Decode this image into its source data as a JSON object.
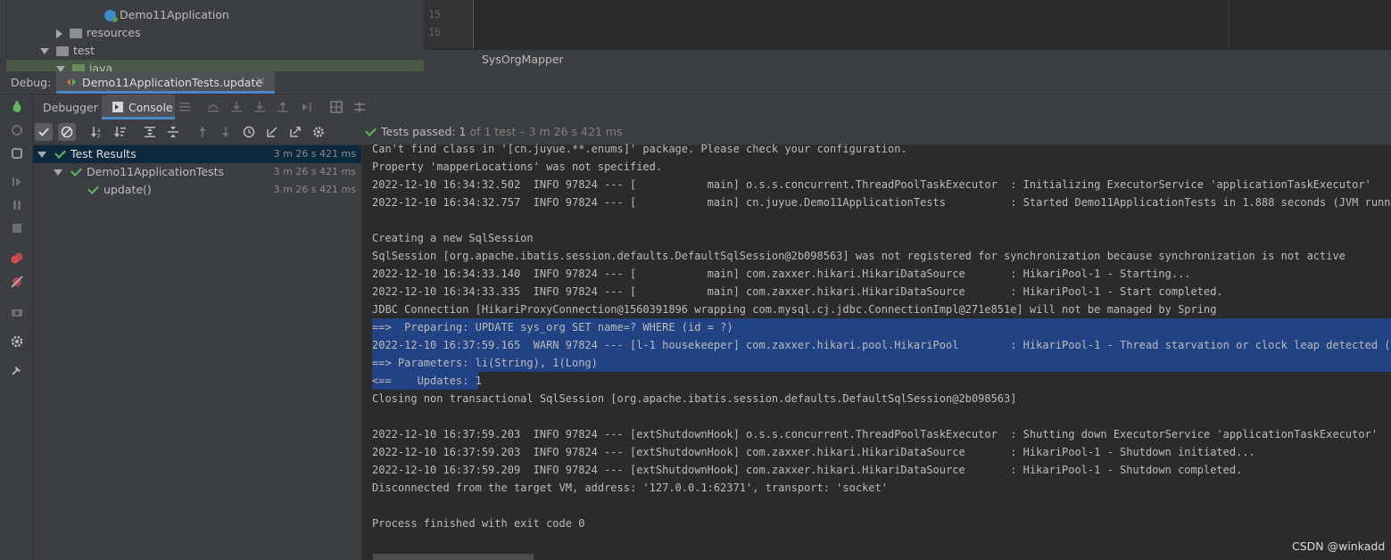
{
  "project_tree": {
    "items": [
      {
        "label": "Demo11Application",
        "kind": "app"
      },
      {
        "label": "resources",
        "kind": "folder"
      },
      {
        "label": "test",
        "kind": "folder"
      },
      {
        "label": "java",
        "kind": "folder"
      }
    ]
  },
  "editor": {
    "line_numbers": [
      "15",
      "16"
    ],
    "tab_label": "SysOrgMapper"
  },
  "debug": {
    "label": "Debug:",
    "session_tab": "Demo11ApplicationTests.update"
  },
  "tabs": {
    "debugger": "Debugger",
    "console": "Console"
  },
  "status": {
    "prefix": "Tests passed: ",
    "passed": "1",
    "rest": " of 1 test – 3 m 26 s 421 ms"
  },
  "test_tree": [
    {
      "label": "Test Results",
      "time": "3 m 26 s 421 ms"
    },
    {
      "label": "Demo11ApplicationTests",
      "time": "3 m 26 s 421 ms"
    },
    {
      "label": "update()",
      "time": "3 m 26 s 421 ms"
    }
  ],
  "console_lines": [
    "Can't find class in '[cn.juyue.**.enums]' package. Please check your configuration.",
    "Property 'mapperLocations' was not specified.",
    "2022-12-10 16:34:32.502  INFO 97824 --- [           main] o.s.s.concurrent.ThreadPoolTaskExecutor  : Initializing ExecutorService 'applicationTaskExecutor'",
    "2022-12-10 16:34:32.757  INFO 97824 --- [           main] cn.juyue.Demo11ApplicationTests          : Started Demo11ApplicationTests in 1.888 seconds (JVM running for",
    "",
    "Creating a new SqlSession",
    "SqlSession [org.apache.ibatis.session.defaults.DefaultSqlSession@2b098563] was not registered for synchronization because synchronization is not active",
    "2022-12-10 16:34:33.140  INFO 97824 --- [           main] com.zaxxer.hikari.HikariDataSource       : HikariPool-1 - Starting...",
    "2022-12-10 16:34:33.335  INFO 97824 --- [           main] com.zaxxer.hikari.HikariDataSource       : HikariPool-1 - Start completed.",
    "JDBC Connection [HikariProxyConnection@1560391896 wrapping com.mysql.cj.jdbc.ConnectionImpl@271e851e] will not be managed by Spring",
    "==>  Preparing: UPDATE sys_org SET name=? WHERE (id = ?)",
    "2022-12-10 16:37:59.165  WARN 97824 --- [l-1 housekeeper] com.zaxxer.hikari.pool.HikariPool        : HikariPool-1 - Thread starvation or clock leap detected (housek",
    "==> Parameters: li(String), 1(Long)",
    "<==    Updates: 1",
    "Closing non transactional SqlSession [org.apache.ibatis.session.defaults.DefaultSqlSession@2b098563]",
    "",
    "2022-12-10 16:37:59.203  INFO 97824 --- [extShutdownHook] o.s.s.concurrent.ThreadPoolTaskExecutor  : Shutting down ExecutorService 'applicationTaskExecutor'",
    "2022-12-10 16:37:59.203  INFO 97824 --- [extShutdownHook] com.zaxxer.hikari.HikariDataSource       : HikariPool-1 - Shutdown initiated...",
    "2022-12-10 16:37:59.209  INFO 97824 --- [extShutdownHook] com.zaxxer.hikari.HikariDataSource       : HikariPool-1 - Shutdown completed.",
    "Disconnected from the target VM, address: '127.0.0.1:62371', transport: 'socket'",
    "",
    "Process finished with exit code 0"
  ],
  "watermark": "CSDN @winkadd",
  "colors": {
    "selection": "#214283",
    "pass_green": "#5fb85f",
    "tab_accent": "#4a88c7"
  }
}
